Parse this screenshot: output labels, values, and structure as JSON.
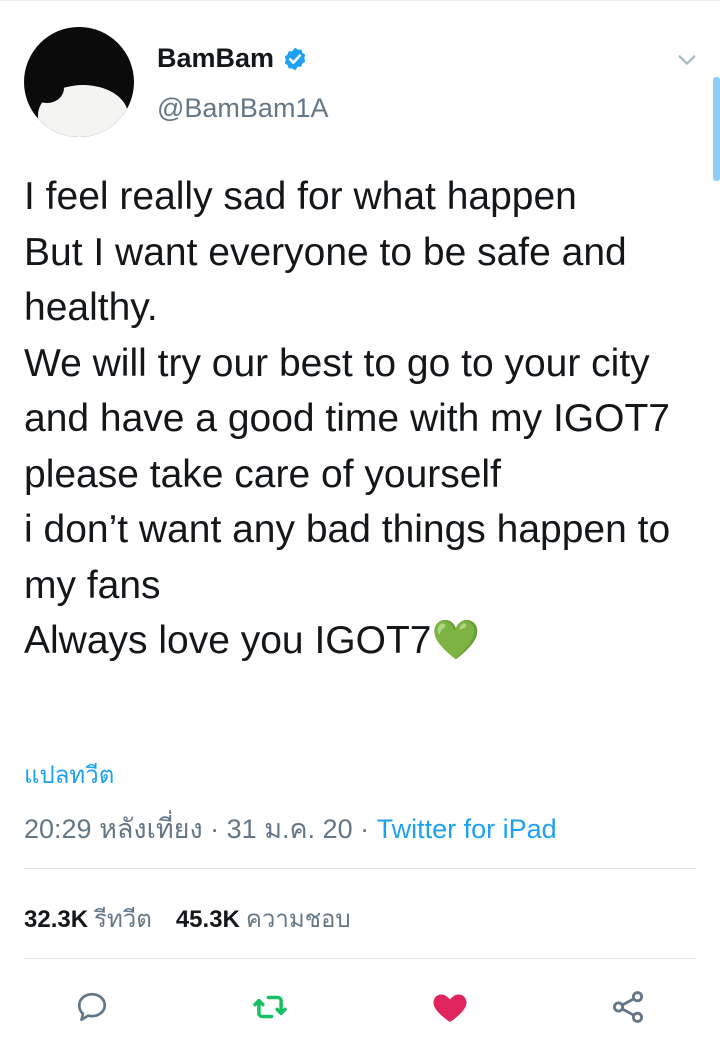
{
  "author": {
    "display_name": "BamBam",
    "handle": "@BamBam1A",
    "verified_icon": "verified-badge-icon"
  },
  "tweet": {
    "text": "I feel really sad for what happen\nBut I want everyone to be safe and healthy.\nWe will try our best to go to your city and have a good time with my IGOT7\nplease take care of yourself\ni don’t want any bad things happen to my fans\nAlways love you IGOT7💚",
    "translate_label": "แปลทวีต",
    "time": "20:29 หลังเที่ยง",
    "separator": "·",
    "date": "31 ม.ค. 20",
    "source": "Twitter for iPad"
  },
  "stats": {
    "retweet_count": "32.3K",
    "retweet_label": "รีทวีต",
    "like_count": "45.3K",
    "like_label": "ความชอบ"
  },
  "actions": [
    {
      "name": "reply",
      "icon": "reply-icon"
    },
    {
      "name": "retweet",
      "icon": "retweet-icon"
    },
    {
      "name": "like",
      "icon": "heart-icon"
    },
    {
      "name": "share",
      "icon": "share-icon"
    }
  ],
  "colors": {
    "accent": "#1da1f2",
    "retweet": "#17bf63",
    "like": "#e0245e",
    "secondary_text": "#657786",
    "heart_emoji": "#77b255"
  }
}
